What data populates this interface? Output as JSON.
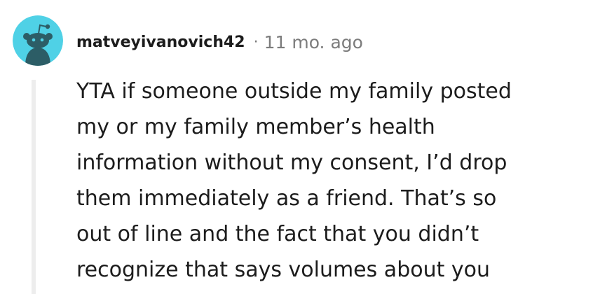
{
  "comment": {
    "author": "matveyivanovich42",
    "separator": "·",
    "timestamp": "11 mo. ago",
    "avatar_icon": "snoo-avatar-icon",
    "avatar_bg_color": "#4fd1e6",
    "body": "YTA if someone outside my family posted\nmy or my family member’s health\ninformation without my consent, I’d drop\nthem immediately as a friend. That’s so\nout of line and the fact that you didn’t\nrecognize that says volumes about you"
  }
}
